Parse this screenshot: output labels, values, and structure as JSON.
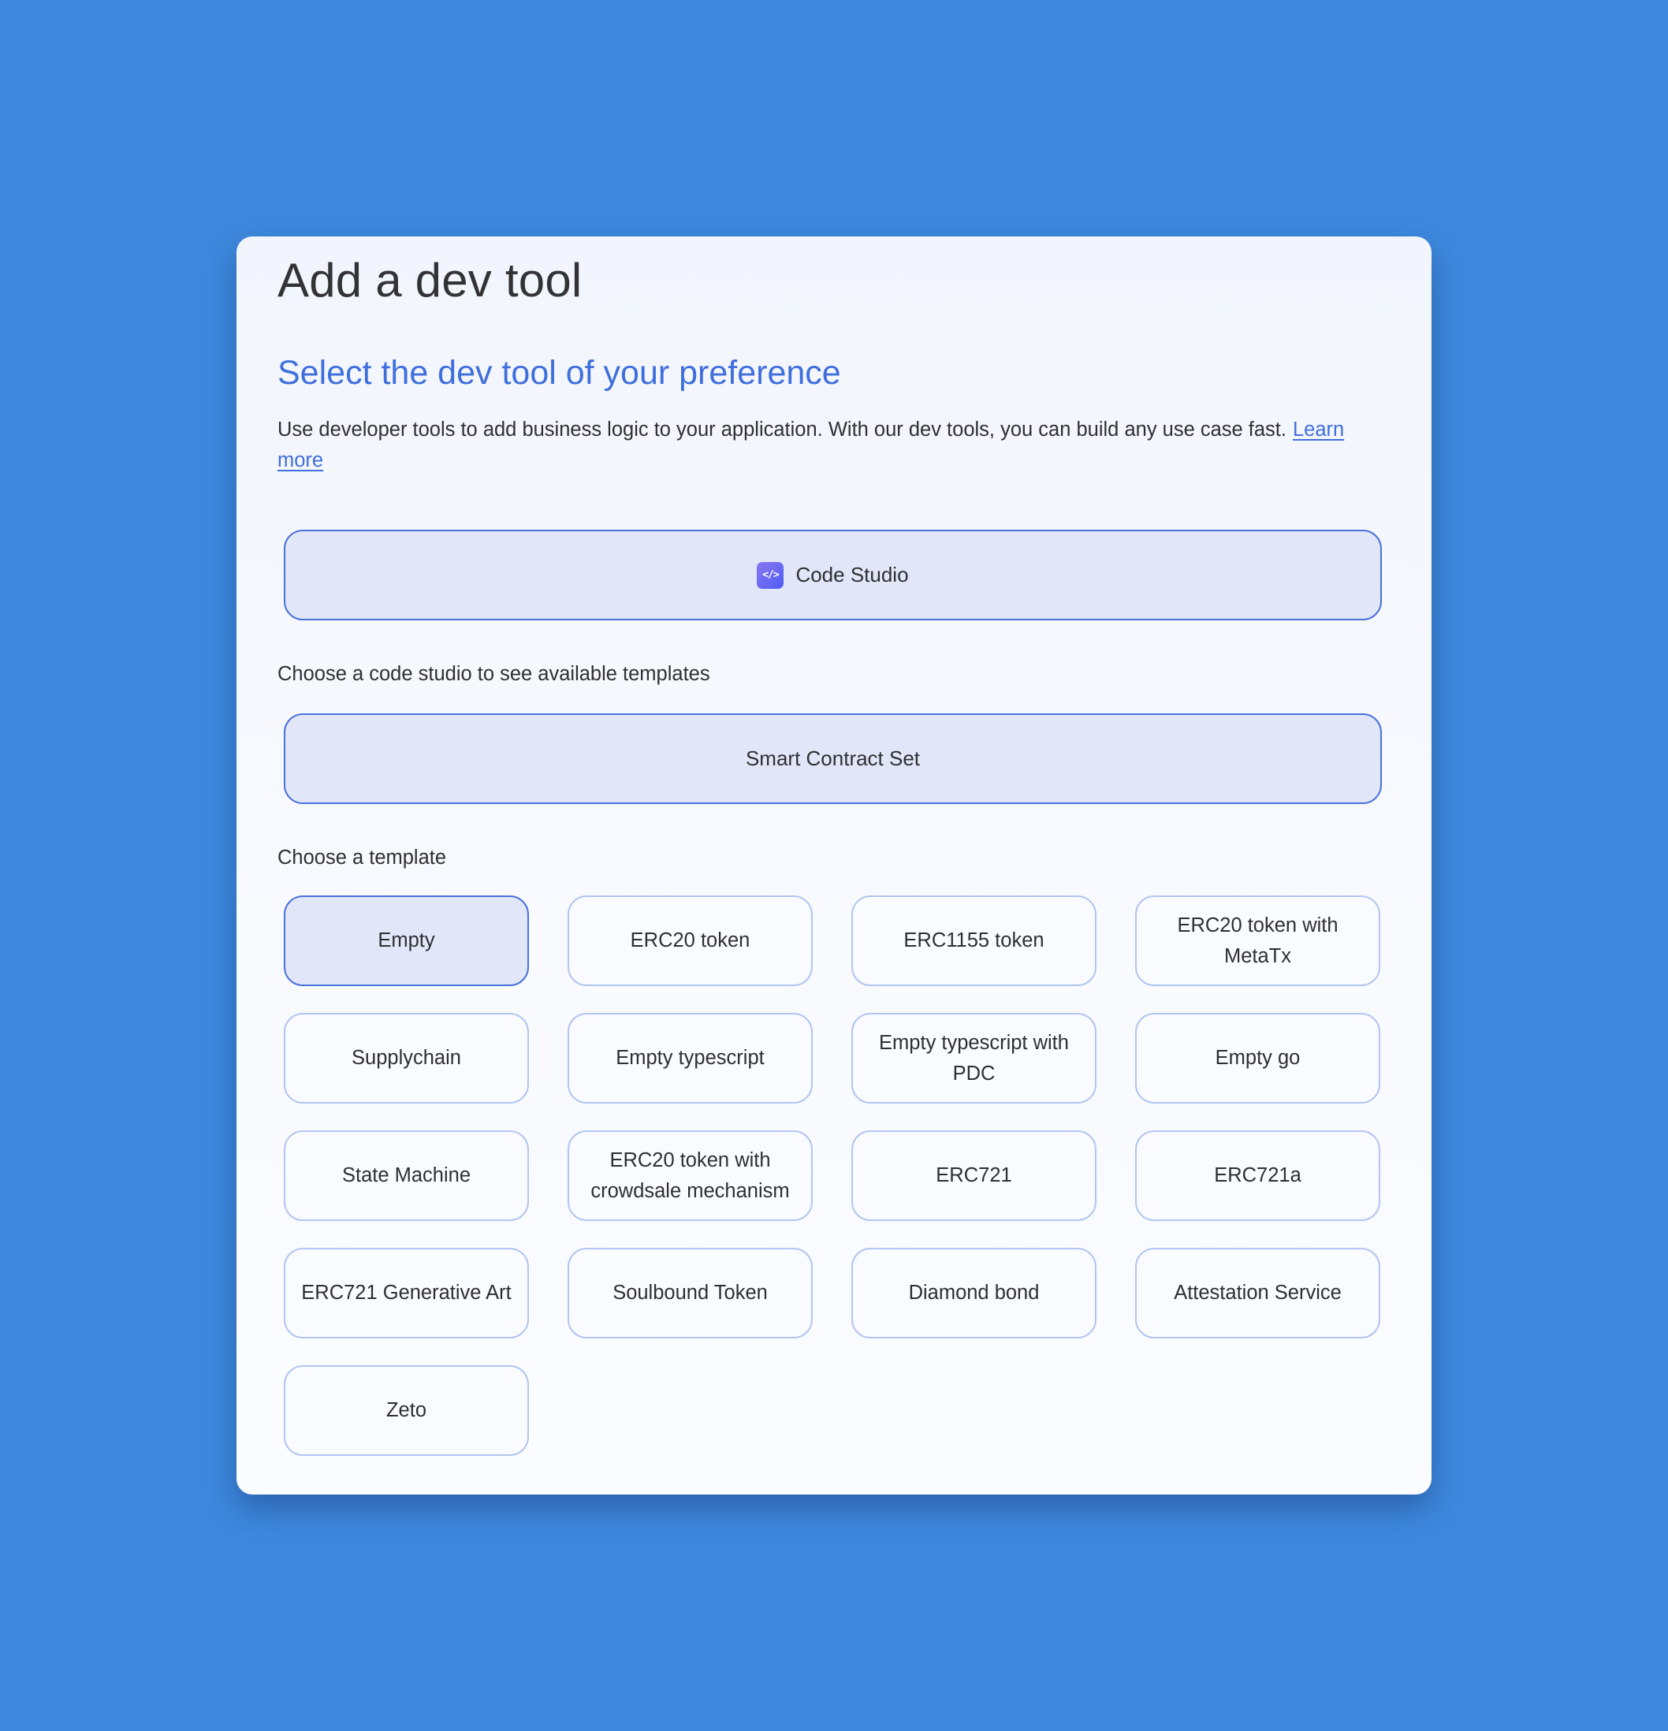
{
  "dialog": {
    "title": "Add a dev tool",
    "subtitle": "Select the dev tool of your preference",
    "description": "Use developer tools to add business logic to your application. With our dev tools, you can build any use case fast.",
    "learn_more_label": "Learn more"
  },
  "dev_tool": {
    "label": "Code Studio",
    "icon": "code-brackets-icon",
    "icon_glyph": "</>",
    "selected": true
  },
  "code_studio_section": {
    "label": "Choose a code studio to see available templates",
    "option_label": "Smart Contract Set",
    "selected": true
  },
  "template_section": {
    "label": "Choose a template",
    "templates": [
      {
        "label": "Empty",
        "selected": true
      },
      {
        "label": "ERC20 token",
        "selected": false
      },
      {
        "label": "ERC1155 token",
        "selected": false
      },
      {
        "label": "ERC20 token with MetaTx",
        "selected": false
      },
      {
        "label": "Supplychain",
        "selected": false
      },
      {
        "label": "Empty typescript",
        "selected": false
      },
      {
        "label": "Empty typescript with PDC",
        "selected": false
      },
      {
        "label": "Empty go",
        "selected": false
      },
      {
        "label": "State Machine",
        "selected": false
      },
      {
        "label": "ERC20 token with crowdsale mechanism",
        "selected": false
      },
      {
        "label": "ERC721",
        "selected": false
      },
      {
        "label": "ERC721a",
        "selected": false
      },
      {
        "label": "ERC721 Generative Art",
        "selected": false
      },
      {
        "label": "Soulbound Token",
        "selected": false
      },
      {
        "label": "Diamond bond",
        "selected": false
      },
      {
        "label": "Attestation Service",
        "selected": false
      },
      {
        "label": "Zeto",
        "selected": false
      }
    ]
  },
  "colors": {
    "background": "#3e89de",
    "accent": "#3f6fdc",
    "selected_border": "#4a72dc",
    "selected_fill": "#e1e7f8",
    "unselected_border": "#b3c5f0"
  }
}
